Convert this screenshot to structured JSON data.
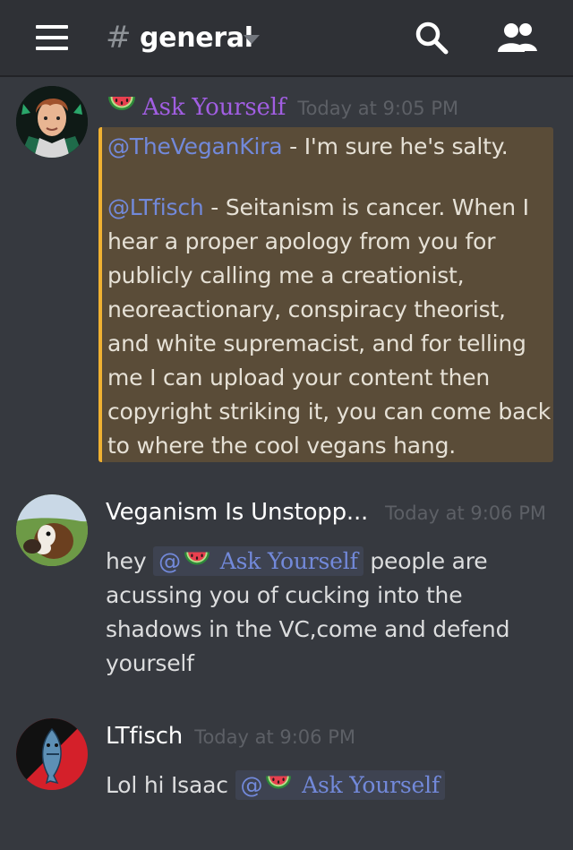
{
  "header": {
    "channel_hash": "#",
    "channel_name": "general"
  },
  "messages": [
    {
      "author": "Ask Yourself",
      "timestamp": "Today at 9:05 PM",
      "lines": [
        {
          "mention": "@TheVeganKira",
          "text": " - I'm sure he's salty."
        },
        {
          "mention": "@LTfisch",
          "text": " - Seitanism is cancer.  When I"
        },
        {
          "text": "hear a proper apology from you for"
        },
        {
          "text": "publicly calling me a creationist,"
        },
        {
          "text": "neoreactionary, conspiracy theorist,"
        },
        {
          "text": "and white supremacist, and for telling"
        },
        {
          "text": "me I can upload your content then"
        },
        {
          "text": "copyright striking it, you can come back"
        },
        {
          "text": "to where the cool vegans hang."
        }
      ]
    },
    {
      "author": "Veganism Is Unstopp...",
      "timestamp": "Today at 9:06 PM",
      "prefix": "hey",
      "mention_at": "@",
      "mention_name": "Ask Yourself",
      "suffix": "people are",
      "lines": [
        "acussing you of cucking into the",
        "shadows in the VC,come and defend",
        "yourself"
      ]
    },
    {
      "author": "LTfisch",
      "timestamp": "Today at 9:06 PM",
      "prefix": "Lol hi Isaac",
      "mention_at": "@",
      "mention_name": "Ask Yourself"
    }
  ],
  "colors": {
    "background": "#36393f",
    "header": "#2f3136",
    "mention": "#7289da",
    "highlight": "#5a4c38",
    "highlight_bar": "#f0b132",
    "author_role": "#a15ee2"
  },
  "icons": [
    "menu-icon",
    "search-icon",
    "members-icon",
    "watermelon-icon"
  ]
}
